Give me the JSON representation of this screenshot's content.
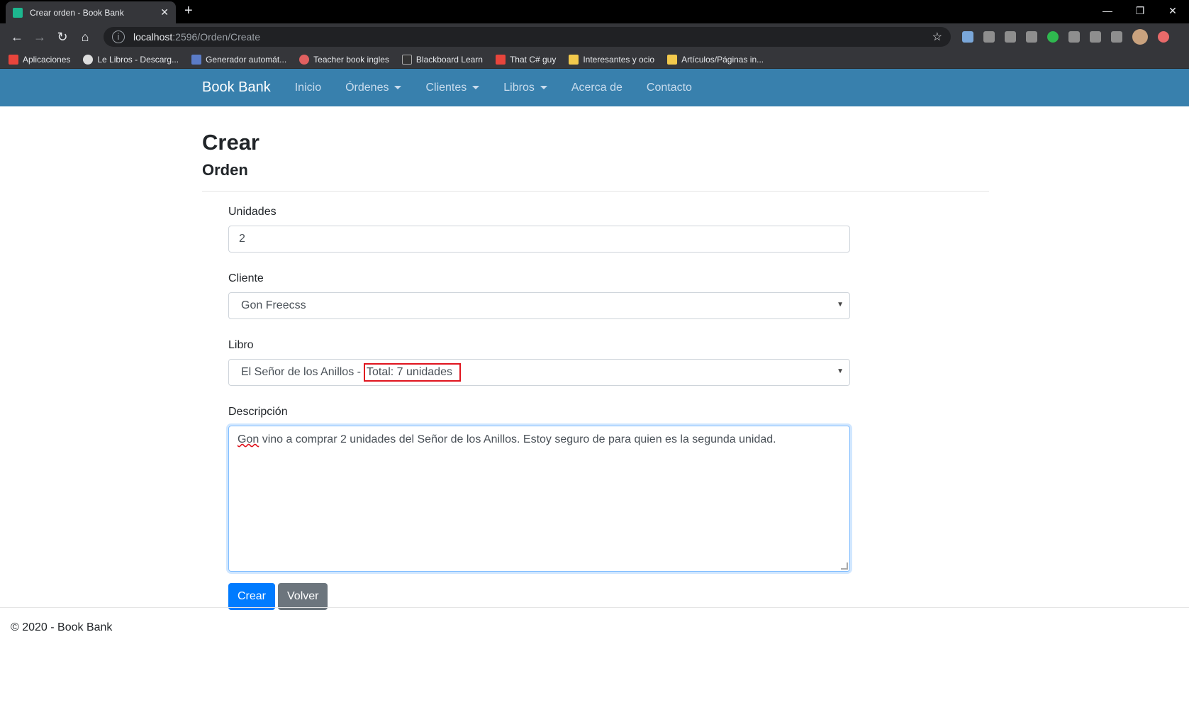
{
  "browser": {
    "tab_title": "Crear orden - Book Bank",
    "new_tab": "+",
    "url_host": "localhost",
    "url_path": ":2596/Orden/Create",
    "bookmarks": [
      {
        "label": "Aplicaciones",
        "color": "#e8453c"
      },
      {
        "label": "Le Libros - Descarg...",
        "color": "#dddddd"
      },
      {
        "label": "Generador automát...",
        "color": "#5b7cc7"
      },
      {
        "label": "Teacher book ingles",
        "color": "#e06060"
      },
      {
        "label": "Blackboard Learn",
        "color": "#333333"
      },
      {
        "label": "That C# guy",
        "color": "#e8453c"
      },
      {
        "label": "Interesantes y ocio",
        "color": "#f2c94c"
      },
      {
        "label": "Artículos/Páginas in...",
        "color": "#f2c94c"
      }
    ]
  },
  "navbar": {
    "brand": "Book Bank",
    "links": [
      {
        "label": "Inicio",
        "dropdown": false
      },
      {
        "label": "Órdenes",
        "dropdown": true
      },
      {
        "label": "Clientes",
        "dropdown": true
      },
      {
        "label": "Libros",
        "dropdown": true
      },
      {
        "label": "Acerca de",
        "dropdown": false
      },
      {
        "label": "Contacto",
        "dropdown": false
      }
    ]
  },
  "page": {
    "title": "Crear",
    "subtitle": "Orden"
  },
  "form": {
    "unidades_label": "Unidades",
    "unidades_value": "2",
    "cliente_label": "Cliente",
    "cliente_value": "Gon Freecss",
    "libro_label": "Libro",
    "libro_value_prefix": "El Señor de los Anillos -",
    "libro_value_total": "Total: 7 unidades",
    "descripcion_label": "Descripción",
    "descripcion_first_word": "Gon",
    "descripcion_rest": " vino a comprar 2 unidades del Señor de los Anillos. Estoy seguro de para quien es la segunda unidad.",
    "crear_button": "Crear",
    "volver_button": "Volver"
  },
  "footer": {
    "text": "© 2020 - Book Bank"
  },
  "colors": {
    "navbar": "#3880ad",
    "primary": "#007bff",
    "secondary": "#6c757d",
    "highlight": "#e0141e"
  }
}
